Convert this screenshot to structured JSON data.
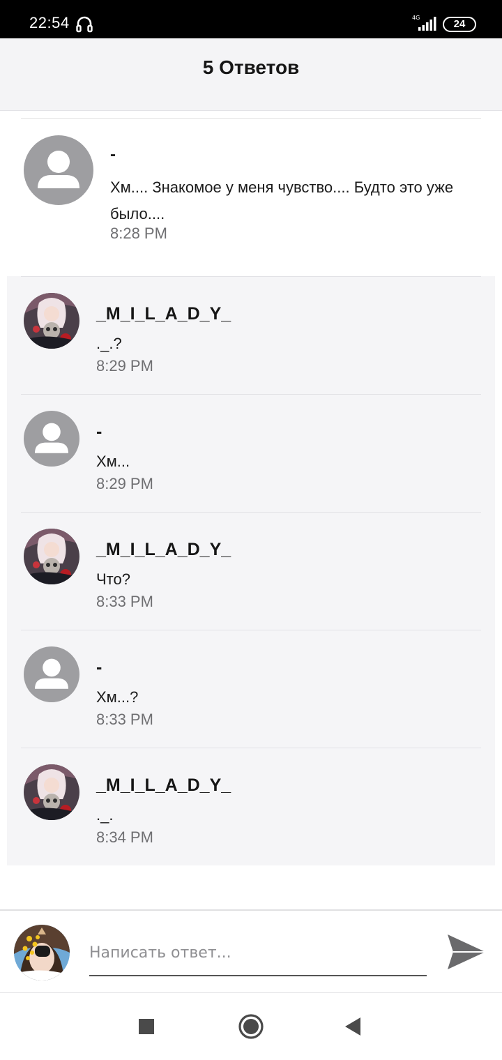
{
  "status_bar": {
    "time": "22:54",
    "network": "4G",
    "battery": "24",
    "icons": [
      "headset-icon",
      "signal-icon",
      "battery-icon"
    ]
  },
  "header": {
    "title": "5 Ответов"
  },
  "root_comment": {
    "author": "-",
    "text": "Хм.... Знакомое у меня чувство.... Будто это уже было....",
    "time": "8:28 PM",
    "avatar": "default-avatar-icon"
  },
  "replies": [
    {
      "author": "_M_I_L_A_D_Y_",
      "text": "._.?",
      "time": "8:29 PM",
      "avatar": "milady-avatar"
    },
    {
      "author": "-",
      "text": "Хм...",
      "time": "8:29 PM",
      "avatar": "default-avatar-icon"
    },
    {
      "author": "_M_I_L_A_D_Y_",
      "text": "Что?",
      "time": "8:33 PM",
      "avatar": "milady-avatar"
    },
    {
      "author": "-",
      "text": "Хм...?",
      "time": "8:33 PM",
      "avatar": "default-avatar-icon"
    },
    {
      "author": "_M_I_L_A_D_Y_",
      "text": "._.",
      "time": "8:34 PM",
      "avatar": "milady-avatar"
    }
  ],
  "composer": {
    "placeholder": "Написать ответ...",
    "value": "",
    "send_icon": "send-icon"
  },
  "nav_bar": {
    "buttons": [
      "recents-icon",
      "home-icon",
      "back-icon"
    ]
  },
  "colors": {
    "status_bar_bg": "#000000",
    "header_bg": "#f4f4f6",
    "replies_bg": "#f5f5f7",
    "time_text": "#6f6f72",
    "default_avatar": "#9e9ea1"
  }
}
